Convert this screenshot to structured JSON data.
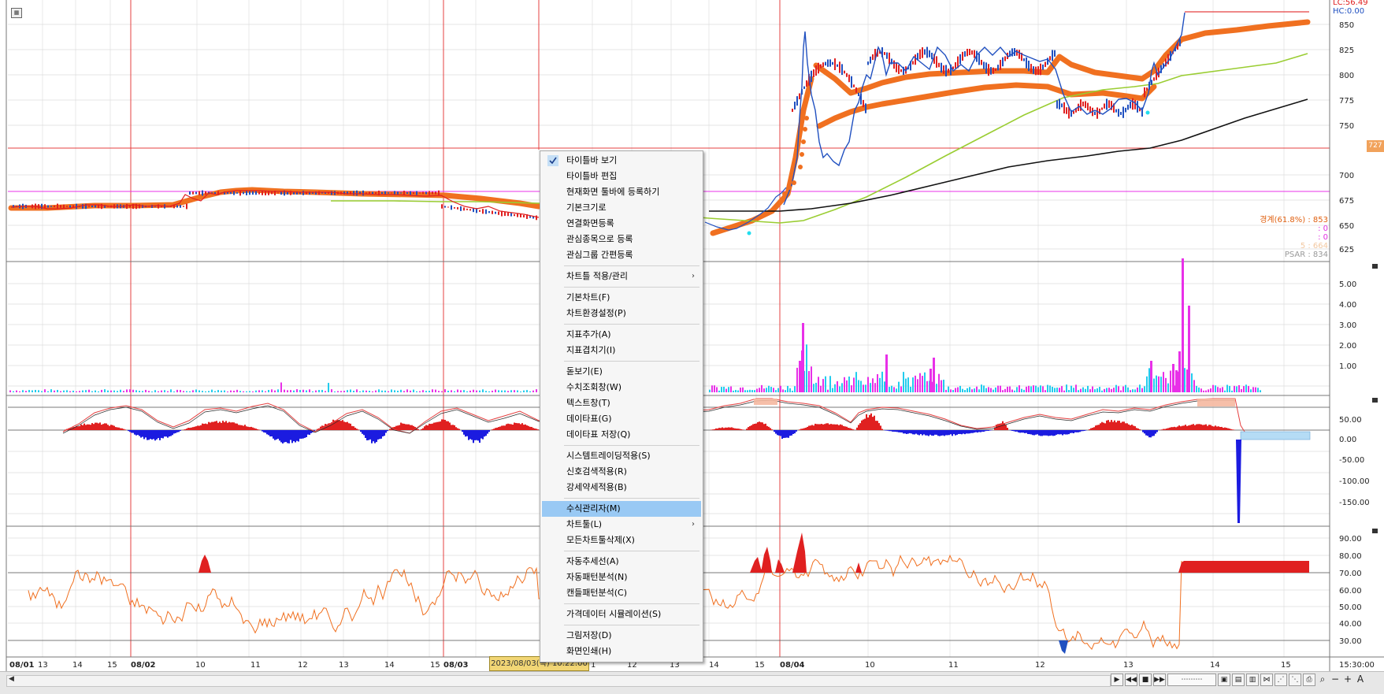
{
  "top_right": {
    "lc": "LC:56.49",
    "hc": "HC:0.00"
  },
  "price_axis": [
    "850",
    "825",
    "800",
    "775",
    "750",
    "700",
    "675",
    "650",
    "625"
  ],
  "price_tag": "727",
  "right_legend": {
    "boundary": "경계(61.8%) : 853",
    "zero1": ": 0",
    "zero2": ": 0",
    "five": "5 : 664",
    "psar": "PSAR : 834"
  },
  "volume_axis": [
    "5.00",
    "4.00",
    "3.00",
    "2.00",
    "1.00"
  ],
  "macd_axis": [
    "50.00",
    "0.00",
    "-50.00",
    "-100.00",
    "-150.00"
  ],
  "rsi_axis": [
    "90.00",
    "80.00",
    "70.00",
    "60.00",
    "50.00",
    "40.00",
    "30.00"
  ],
  "time_axis": {
    "labels": [
      "08/01",
      "13",
      "14",
      "15",
      "08/02",
      "10",
      "11",
      "12",
      "13",
      "14",
      "15",
      "08/03",
      "1",
      "12",
      "13",
      "14",
      "15",
      "08/04",
      "10",
      "11",
      "12",
      "13",
      "14",
      "15"
    ],
    "time": "15:30:00",
    "cursor_time": "2023/08/03(목) 10:22:00"
  },
  "context_menu": {
    "items": [
      {
        "label": "타이틀바 보기",
        "checked": true
      },
      {
        "label": "타이틀바 편집"
      },
      {
        "label": "현재화면 툴바에 등록하기"
      },
      {
        "label": "기본크기로"
      },
      {
        "label": "연결화면등록"
      },
      {
        "label": "관심종목으로 등록"
      },
      {
        "label": "관심그룹 간편등록"
      },
      {
        "sep": true
      },
      {
        "label": "차트틀 적용/관리",
        "submenu": true
      },
      {
        "sep": true
      },
      {
        "label": "기본차트(F)"
      },
      {
        "label": "차트환경설정(P)"
      },
      {
        "sep": true
      },
      {
        "label": "지표추가(A)"
      },
      {
        "label": "지표겹치기(I)"
      },
      {
        "sep": true
      },
      {
        "label": "돋보기(E)"
      },
      {
        "label": "수치조회창(W)"
      },
      {
        "label": "텍스트창(T)"
      },
      {
        "label": "데이타표(G)"
      },
      {
        "label": "데이타표 저장(Q)"
      },
      {
        "sep": true
      },
      {
        "label": "시스템트레이딩적용(S)"
      },
      {
        "label": "신호검색적용(R)"
      },
      {
        "label": "강세약세적용(B)"
      },
      {
        "sep": true
      },
      {
        "label": "수식관리자(M)",
        "highlighted": true
      },
      {
        "label": "차트툴(L)",
        "submenu": true
      },
      {
        "label": "모든차트툴삭제(X)"
      },
      {
        "sep": true
      },
      {
        "label": "자동추세선(A)"
      },
      {
        "label": "자동패턴분석(N)"
      },
      {
        "label": "캔들패턴분석(C)"
      },
      {
        "sep": true
      },
      {
        "label": "가격데이터 시뮬레이션(S)"
      },
      {
        "sep": true
      },
      {
        "label": "그림저장(D)"
      },
      {
        "label": "화면인쇄(H)"
      }
    ]
  },
  "colors": {
    "grid": "#dedede",
    "red_line": "#e54040",
    "magenta_line": "#e830e8",
    "orange_ma": "#f07020",
    "green_ma": "#9acd32",
    "black_ma": "#111111",
    "candle_up": "#e02020",
    "candle_down": "#2050c0",
    "menu_highlight": "#99c9f4"
  },
  "icons": {
    "check": "check-icon",
    "submenu": "chevron-right-icon"
  }
}
